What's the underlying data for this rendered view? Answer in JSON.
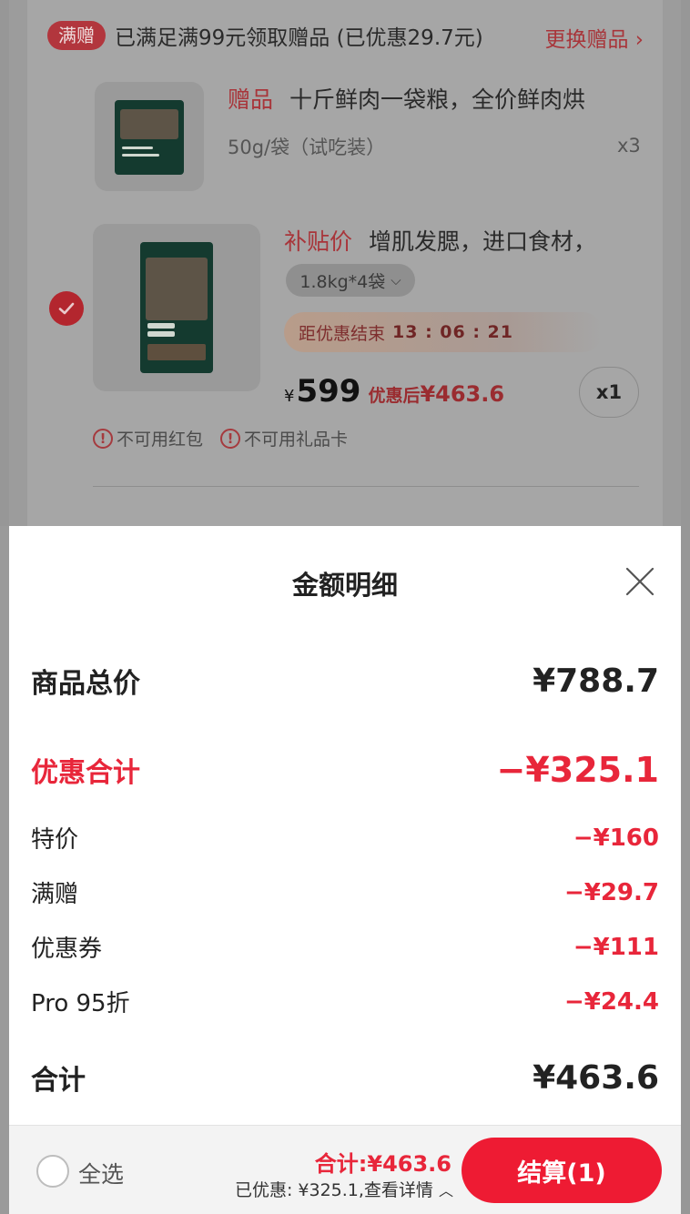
{
  "cart": {
    "gift_tag": "满赠",
    "gift_promo_text": "已满足满99元领取赠品 (已优惠29.7元)",
    "gift_change_label": "更换赠品",
    "gift_item": {
      "badge": "赠品",
      "title": "十斤鲜肉一袋粮，全价鲜肉烘",
      "spec": "50g/袋（试吃装）",
      "qty": "x3"
    },
    "product": {
      "badge": "补贴价",
      "title": "增肌发腮，进口食材，",
      "sku": "1.8kg*4袋",
      "countdown_label": "距优惠结束",
      "countdown_time": "13 : 06 : 21",
      "currency": "¥",
      "price": "599",
      "after_label": "优惠后",
      "after_price": "¥463.6",
      "qty": "x1",
      "checked": true
    },
    "warnings": [
      "不可用红包",
      "不可用礼品卡"
    ]
  },
  "sheet": {
    "title": "金额明细",
    "subtotal_label": "商品总价",
    "subtotal_value": "¥788.7",
    "discount_label": "优惠合计",
    "discount_value": "−¥325.1",
    "items": [
      {
        "label": "特价",
        "value": "−¥160"
      },
      {
        "label": "满赠",
        "value": "−¥29.7"
      },
      {
        "label": "优惠券",
        "value": "−¥111"
      },
      {
        "label": "Pro 95折",
        "value": "−¥24.4"
      }
    ],
    "total_label": "合计",
    "total_value": "¥463.6"
  },
  "bar": {
    "select_all": "全选",
    "total": "合计:¥463.6",
    "saved": "已优惠: ¥325.1,查看详情",
    "checkout": "结算(1)"
  },
  "colors": {
    "accent": "#ee1b33",
    "discount_text": "#e8263a",
    "overlay": "#9c9c9c"
  }
}
